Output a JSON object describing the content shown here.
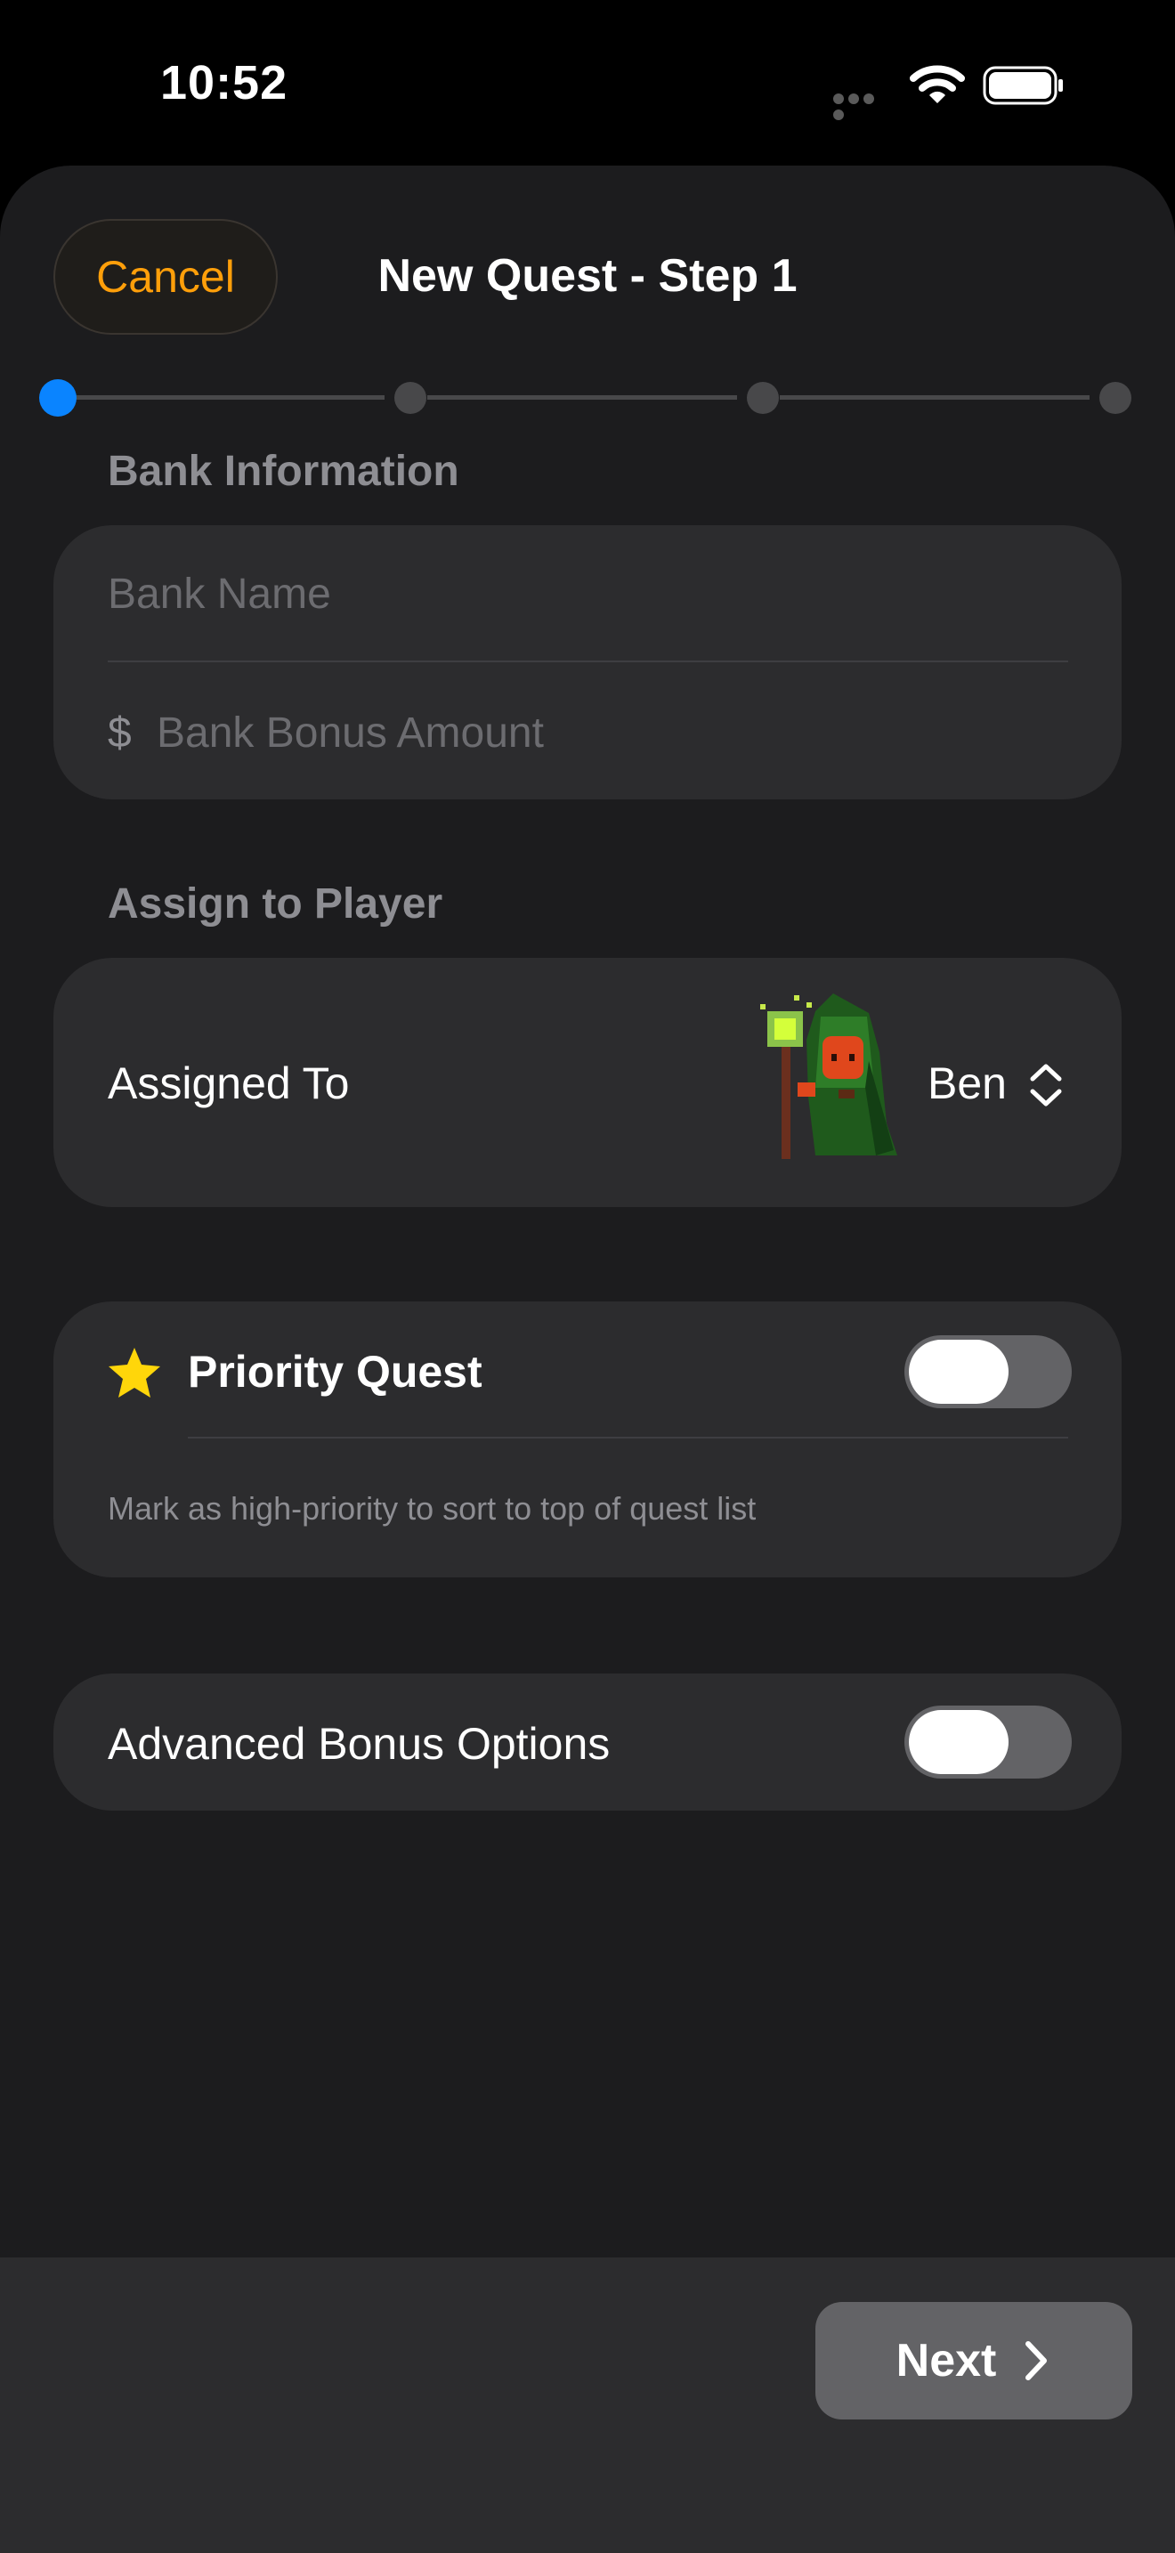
{
  "status_bar": {
    "time": "10:52",
    "icons": [
      "signal-dots-icon",
      "wifi-icon",
      "battery-icon"
    ]
  },
  "navigation": {
    "cancel_label": "Cancel",
    "title": "New Quest - Step 1"
  },
  "progress": {
    "current_step": 1,
    "total_steps": 4
  },
  "bank_information": {
    "header": "Bank Information",
    "bank_name_placeholder": "Bank Name",
    "currency_symbol": "$",
    "bonus_amount_placeholder": "Bank Bonus Amount"
  },
  "assign_to_player": {
    "header": "Assign to Player",
    "label": "Assigned To",
    "selected_player": "Ben",
    "avatar_icon": "wizard-avatar-icon",
    "picker_icon": "chevron-up-down-icon"
  },
  "priority_quest": {
    "icon": "star-icon",
    "label": "Priority Quest",
    "enabled": false,
    "footnote": "Mark as high-priority to sort to top of quest list"
  },
  "advanced_bonus": {
    "label": "Advanced Bonus Options",
    "enabled": false
  },
  "footer": {
    "next_label": "Next",
    "next_icon": "chevron-right-icon"
  },
  "colors": {
    "accent": "#ff9f0a",
    "step_active": "#0a84ff",
    "star": "#ffd60a",
    "sheet_background": "#1c1c1e",
    "card_background": "#2c2c2e"
  }
}
